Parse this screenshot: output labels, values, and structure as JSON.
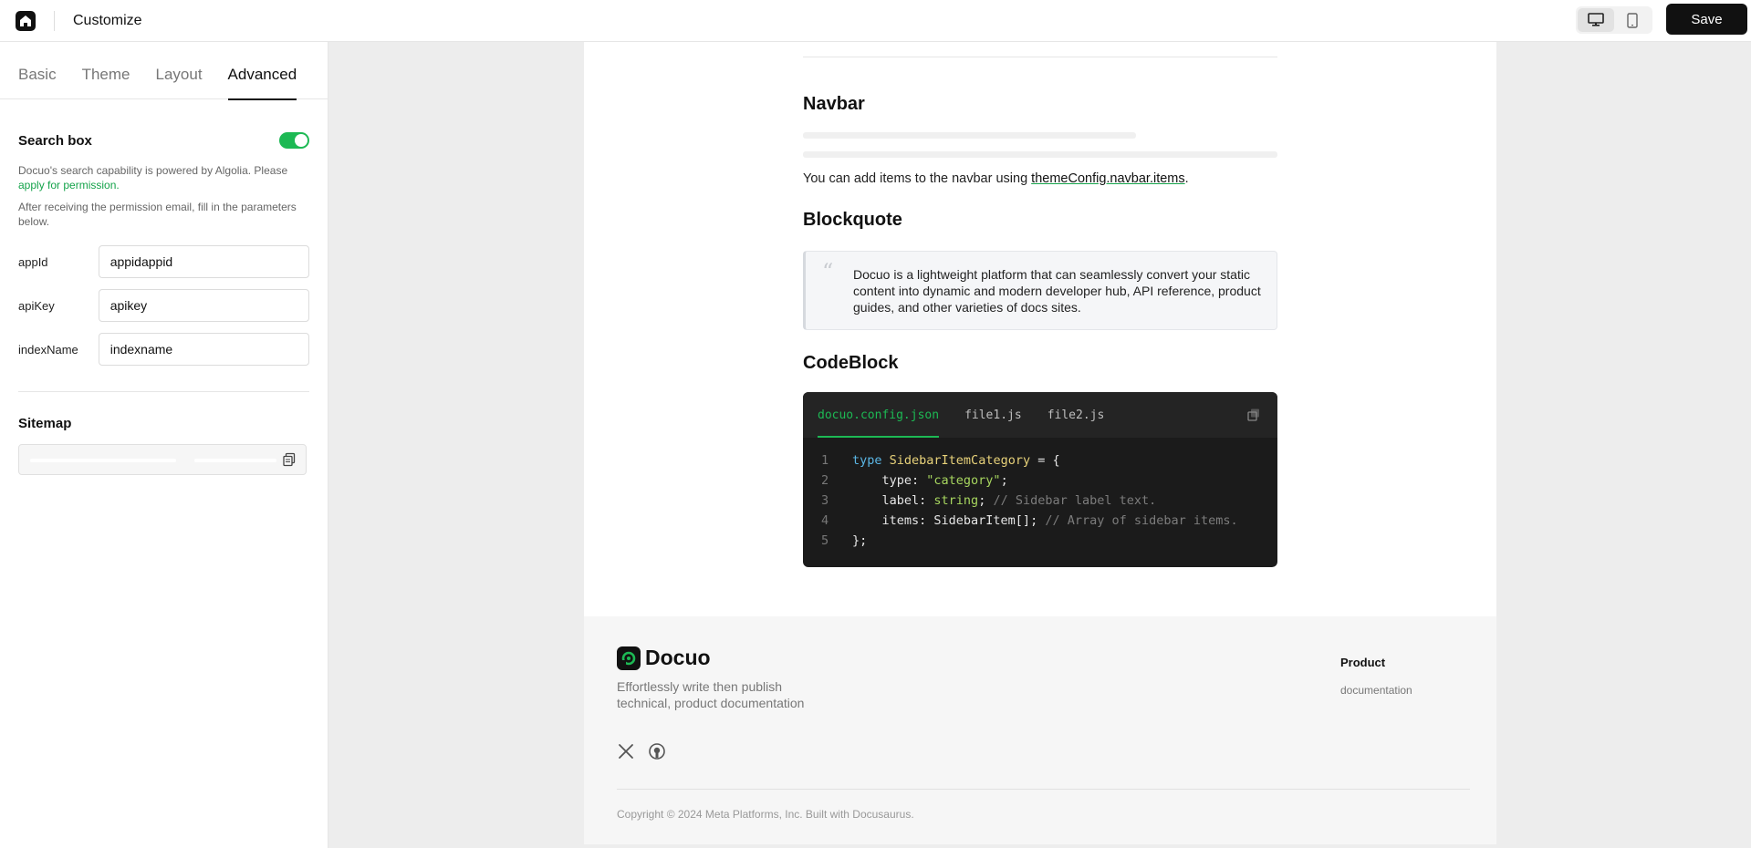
{
  "topbar": {
    "title": "Customize",
    "save_label": "Save"
  },
  "sidebar": {
    "tabs": [
      {
        "label": "Basic"
      },
      {
        "label": "Theme"
      },
      {
        "label": "Layout"
      },
      {
        "label": "Advanced"
      }
    ],
    "search": {
      "label": "Search box",
      "enabled": true,
      "desc_prefix": "Docuo's search capability is powered by Algolia. Please ",
      "desc_link": "apply for permission.",
      "desc2": "After receiving the permission email, fill in the parameters below."
    },
    "fields": [
      {
        "label": "appId",
        "value": "appidappid"
      },
      {
        "label": "apiKey",
        "value": "apikey"
      },
      {
        "label": "indexName",
        "value": "indexname"
      }
    ],
    "sitemap": {
      "label": "Sitemap"
    }
  },
  "preview": {
    "navbar": {
      "title": "Navbar",
      "text_prefix": "You can add items to the navbar using ",
      "text_link": "themeConfig.navbar.items",
      "text_suffix": "."
    },
    "blockquote": {
      "title": "Blockquote",
      "quote_mark": "“",
      "text": "Docuo is a lightweight platform that can seamlessly convert your static content into dynamic and modern developer hub, API reference, product guides, and other varieties of docs sites."
    },
    "codeblock": {
      "title": "CodeBlock",
      "tabs": [
        "docuo.config.json",
        "file1.js",
        "file2.js"
      ],
      "line_numbers": [
        "1",
        "2",
        "3",
        "4",
        "5"
      ]
    }
  },
  "footer": {
    "brand": "Docuo",
    "tagline": "Effortlessly write then publish technical, product documentation",
    "product_title": "Product",
    "product_link": "documentation",
    "copyright": "Copyright © 2024 Meta Platforms, Inc. Built with Docusaurus."
  },
  "colors": {
    "accent": "#1db954",
    "link_green": "#14a34a",
    "code_bg": "#1b1b1b"
  }
}
